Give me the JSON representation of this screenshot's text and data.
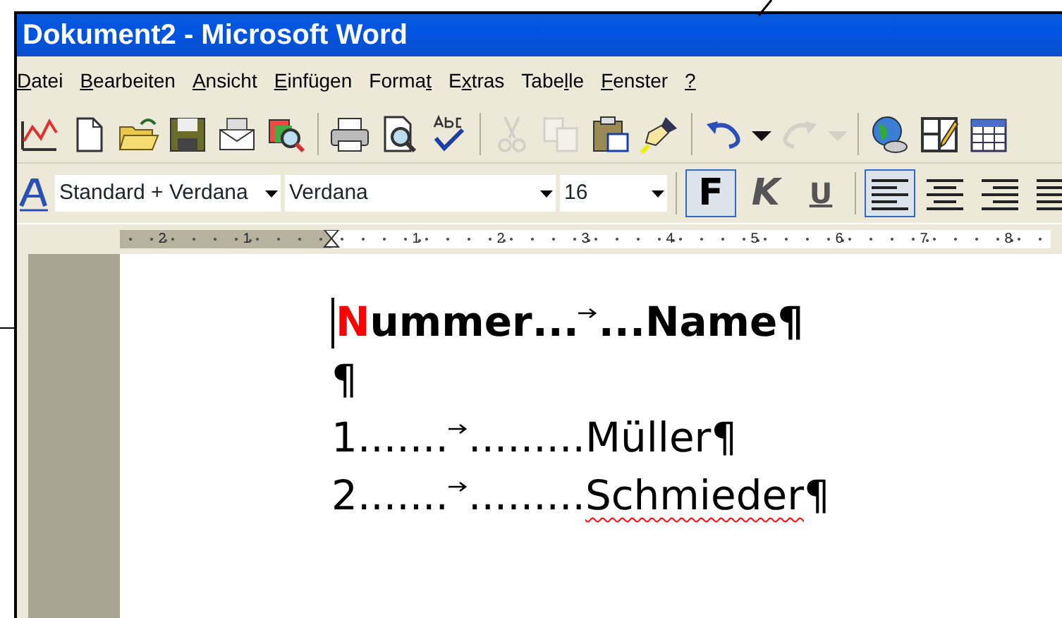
{
  "window": {
    "title": "Dokument2 - Microsoft Word"
  },
  "menu": [
    {
      "key": "D",
      "post": "atei"
    },
    {
      "key": "B",
      "post": "earbeiten"
    },
    {
      "key": "A",
      "post": "nsicht"
    },
    {
      "key": "E",
      "post": "infügen"
    },
    {
      "pre": "Forma",
      "key": "t"
    },
    {
      "pre": "E",
      "key": "x",
      "post": "tras"
    },
    {
      "pre": "Tabe",
      "key": "l",
      "post": "le"
    },
    {
      "key": "F",
      "post": "enster"
    },
    {
      "key": "?"
    }
  ],
  "standard_toolbar": [
    {
      "kind": "chart",
      "disabled": false
    },
    {
      "kind": "new",
      "disabled": false
    },
    {
      "kind": "open",
      "disabled": false
    },
    {
      "kind": "save",
      "disabled": false
    },
    {
      "kind": "mail",
      "disabled": false
    },
    {
      "kind": "research",
      "disabled": false
    },
    {
      "kind": "separator"
    },
    {
      "kind": "print",
      "disabled": false
    },
    {
      "kind": "preview",
      "disabled": false
    },
    {
      "kind": "spelling",
      "disabled": false
    },
    {
      "kind": "separator"
    },
    {
      "kind": "cut",
      "disabled": true
    },
    {
      "kind": "copy",
      "disabled": true
    },
    {
      "kind": "paste",
      "disabled": false
    },
    {
      "kind": "painter",
      "disabled": false
    },
    {
      "kind": "separator"
    },
    {
      "kind": "undo",
      "disabled": false
    },
    {
      "kind": "dropdown",
      "disabled": false
    },
    {
      "kind": "redo",
      "disabled": true
    },
    {
      "kind": "dropdown",
      "disabled": true
    },
    {
      "kind": "separator"
    },
    {
      "kind": "globe",
      "disabled": false
    },
    {
      "kind": "drawtable",
      "disabled": false
    },
    {
      "kind": "table",
      "disabled": false
    }
  ],
  "format_toolbar": {
    "style": "Standard + Verdana",
    "font": "Verdana",
    "size": "16",
    "text_buttons": [
      {
        "label": "F",
        "kind": "bold",
        "selected": true
      },
      {
        "label": "K",
        "kind": "italic",
        "selected": false
      },
      {
        "label": "U",
        "kind": "underline",
        "selected": false
      }
    ],
    "align_buttons": [
      {
        "kind": "left",
        "selected": true
      },
      {
        "kind": "center",
        "selected": false
      },
      {
        "kind": "right",
        "selected": false
      },
      {
        "kind": "justify",
        "selected": false
      }
    ]
  },
  "ruler": {
    "left_labels": [
      "2",
      "1"
    ],
    "right_labels": [
      "1",
      "2",
      "3",
      "4",
      "5",
      "6",
      "7",
      "8"
    ]
  },
  "document": {
    "paragraphs": [
      {
        "bold": true,
        "cursor": true,
        "first": {
          "accent": "N",
          "text": "ummer"
        },
        "leader_before": "...",
        "leader_after": "...",
        "second": "Name",
        "misspelled": false,
        "mark": "¶"
      },
      {
        "bold": false,
        "cursor": false,
        "mark": "¶"
      },
      {
        "bold": false,
        "cursor": false,
        "first": {
          "text": "1"
        },
        "leader_before": ".......",
        "leader_after": ".........",
        "second": "Müller",
        "misspelled": false,
        "mark": "¶"
      },
      {
        "bold": false,
        "cursor": false,
        "first": {
          "text": "2"
        },
        "leader_before": ".......",
        "leader_after": ".........",
        "second": "Schmieder",
        "misspelled": true,
        "mark": "¶"
      }
    ]
  }
}
